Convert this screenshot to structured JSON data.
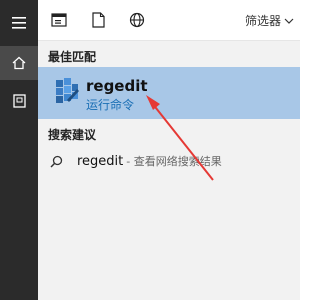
{
  "rail": {
    "menu_icon": "hamburger-menu-icon",
    "home_icon": "home-icon",
    "notebook_icon": "notebook-icon"
  },
  "topbar": {
    "icons": [
      "apps-icon",
      "documents-icon",
      "web-icon"
    ],
    "filter_label": "筛选器",
    "filter_chevron": "chevron-down-icon"
  },
  "best_match": {
    "section_title": "最佳匹配",
    "app_name": "regedit",
    "app_subtitle": "运行命令",
    "app_icon": "regedit-icon"
  },
  "suggestions": {
    "section_title": "搜索建议",
    "items": [
      {
        "term": "regedit",
        "description": "- 查看网络搜索结果",
        "icon": "search-icon"
      }
    ]
  },
  "colors": {
    "rail_bg": "#2b2b2b",
    "panel_bg": "#f2f2f2",
    "selected_bg": "#a8c7e7",
    "accent_blue": "#1a6fb5",
    "annotation_red": "#e53935"
  }
}
